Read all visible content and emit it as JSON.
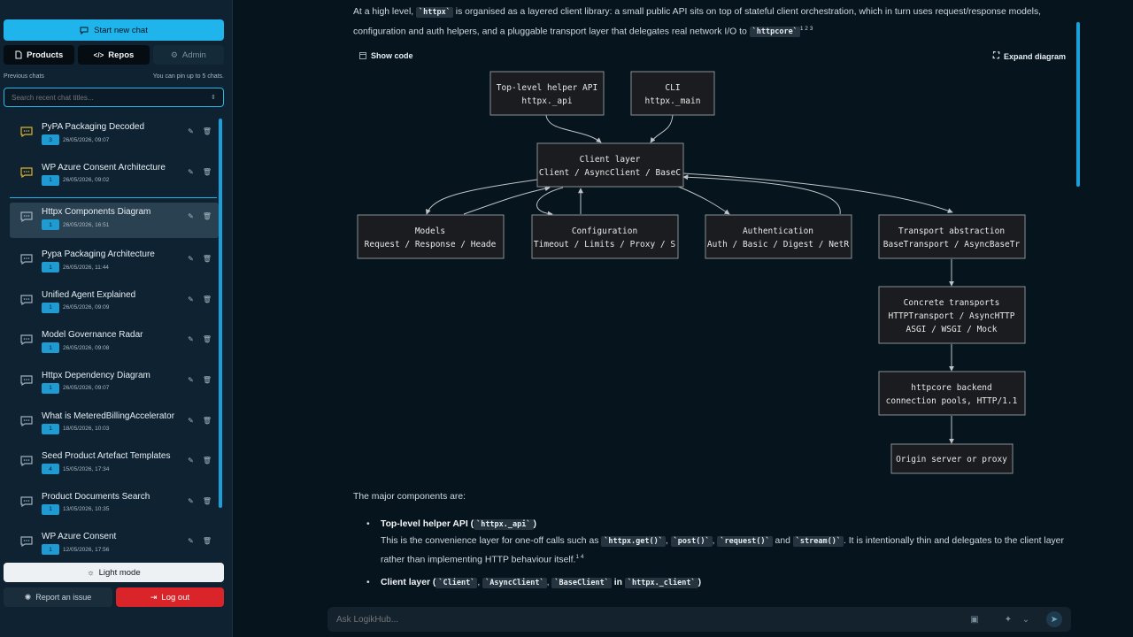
{
  "sidebar": {
    "start_chat": "Start new chat",
    "tabs": [
      "Products",
      "Repos",
      "Admin"
    ],
    "previous_chats_label": "Previous chats",
    "pin_hint": "You can pin up to 5 chats.",
    "search_placeholder": "Search recent chat titles...",
    "chats": [
      {
        "title": "PyPA Packaging Decoded",
        "badge": "3",
        "date": "26/05/2026, 09:07",
        "icon": "chat-bubble-amber-icon"
      },
      {
        "title": "WP Azure Consent Architecture",
        "badge": "1",
        "date": "26/05/2026, 09:02",
        "icon": "chat-bubble-amber-icon"
      },
      {
        "title": "Httpx Components Diagram",
        "badge": "1",
        "date": "26/05/2026, 16:51",
        "icon": "chat-bubble-icon"
      },
      {
        "title": "Pypa Packaging Architecture",
        "badge": "1",
        "date": "26/05/2026, 11:44",
        "icon": "chat-bubble-icon"
      },
      {
        "title": "Unified Agent Explained",
        "badge": "1",
        "date": "26/05/2026, 09:09",
        "icon": "chat-bubble-icon"
      },
      {
        "title": "Model Governance Radar",
        "badge": "1",
        "date": "26/05/2026, 09:08",
        "icon": "chat-bubble-icon"
      },
      {
        "title": "Httpx Dependency Diagram",
        "badge": "1",
        "date": "26/05/2026, 09:07",
        "icon": "chat-bubble-icon"
      },
      {
        "title": "What is MeteredBillingAccelerator",
        "badge": "1",
        "date": "18/05/2026, 10:03",
        "icon": "chat-bubble-icon"
      },
      {
        "title": "Seed Product Artefact Templates",
        "badge": "4",
        "date": "15/05/2026, 17:34",
        "icon": "chat-bubble-icon"
      },
      {
        "title": "Product Documents Search",
        "badge": "1",
        "date": "13/05/2026, 10:35",
        "icon": "chat-bubble-icon"
      },
      {
        "title": "WP Azure Consent",
        "badge": "1",
        "date": "12/05/2026, 17:56",
        "icon": "chat-bubble-icon"
      }
    ],
    "light_mode": "Light mode",
    "report_issue": "Report an issue",
    "log_out": "Log out"
  },
  "main": {
    "intro_a": "At a high level, ",
    "intro_code1": "`httpx`",
    "intro_b": " is organised as a layered client library: a small public API sits on top of stateful client orchestration, which in turn uses request/response models, configuration and auth helpers, and a pluggable transport layer that delegates real network I/O to ",
    "intro_code2": "`httpcore`",
    "intro_refs": "1 2 3",
    "show_code": "Show code",
    "expand_diagram": "Expand diagram",
    "diagram": {
      "helper": [
        "Top-level helper API",
        "httpx._api"
      ],
      "cli": [
        "CLI",
        "httpx._main"
      ],
      "client": [
        "Client layer",
        "Client / AsyncClient / BaseC"
      ],
      "models": [
        "Models",
        "Request / Response / Heade"
      ],
      "config": [
        "Configuration",
        "Timeout / Limits / Proxy / S"
      ],
      "auth": [
        "Authentication",
        "Auth / Basic / Digest / NetR"
      ],
      "transport": [
        "Transport abstraction",
        "BaseTransport / AsyncBaseTr"
      ],
      "concrete": [
        "Concrete transports",
        "HTTPTransport / AsyncHTTP",
        "ASGI / WSGI / Mock"
      ],
      "httpcore": [
        "httpcore backend",
        "connection pools, HTTP/1.1"
      ],
      "origin": [
        "Origin server or proxy"
      ]
    },
    "major_components": "The major components are:",
    "bullet1_title": "Top-level helper API (",
    "bullet1_code": "`httpx._api`",
    "bullet1_close": ")",
    "bullet1_a": "This is the convenience layer for one-off calls such as ",
    "bullet1_codes": [
      "`httpx.get()`",
      "`post()`",
      "`request()`",
      "`stream()`"
    ],
    "bullet1_b": ". It is intentionally thin and delegates to the client layer rather than implementing HTTP behaviour itself.",
    "bullet1_refs": "1 4",
    "bullet2_title": "Client layer (",
    "bullet2_codes": [
      "`Client`",
      "`AsyncClient`",
      "`BaseClient`"
    ],
    "bullet2_in": " in ",
    "bullet2_code_mod": "`httpx._client`",
    "bullet2_close": ")",
    "composer_placeholder": "Ask LogikHub..."
  },
  "colors": {
    "accent": "#20b4ec",
    "danger": "#d9252a",
    "bg": "#06141e",
    "sidebar": "#0e2231"
  }
}
